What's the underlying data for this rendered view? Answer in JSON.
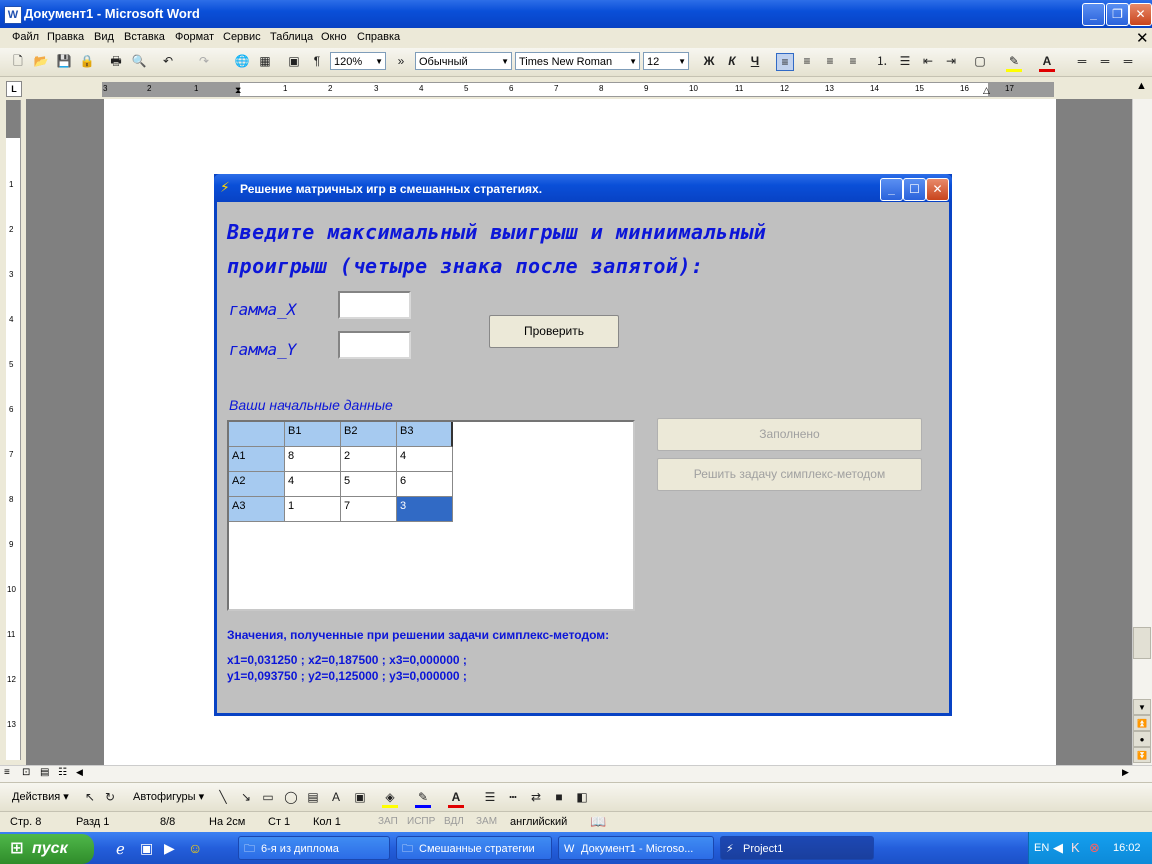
{
  "window": {
    "title": "Документ1 - Microsoft Word",
    "icon_label": "W"
  },
  "menu": [
    "Файл",
    "Правка",
    "Вид",
    "Вставка",
    "Формат",
    "Сервис",
    "Таблица",
    "Окно",
    "Справка"
  ],
  "toolbar": {
    "zoom": "120%",
    "style": "Обычный",
    "font": "Times New Roman",
    "size": "12",
    "bold": "Ж",
    "italic": "К",
    "underline": "Ч"
  },
  "ruler": {
    "ticks": [
      "3",
      "2",
      "1",
      "1",
      "2",
      "3",
      "4",
      "5",
      "6",
      "7",
      "8",
      "9",
      "10",
      "11",
      "12",
      "13",
      "14",
      "15",
      "16",
      "17"
    ]
  },
  "vruler": {
    "ticks": [
      "1",
      "2",
      "3",
      "4",
      "5",
      "6",
      "7",
      "8",
      "9",
      "10",
      "11",
      "12",
      "13"
    ]
  },
  "dialog": {
    "title": "Решение матричных игр в смешанных стратегиях.",
    "heading_line1": "Введите максимальный выигрыш и миниимальный",
    "heading_line2": "проигрыш (четыре знака после запятой):",
    "gamma_x_label": "гамма_X",
    "gamma_y_label": "гамма_Y",
    "gamma_x_value": "",
    "gamma_y_value": "",
    "check_button": "Проверить",
    "data_caption": "Ваши начальные данные",
    "grid": {
      "col_headers": [
        "B1",
        "B2",
        "B3"
      ],
      "rows": [
        {
          "label": "A1",
          "values": [
            "8",
            "2",
            "4"
          ]
        },
        {
          "label": "A2",
          "values": [
            "4",
            "5",
            "6"
          ]
        },
        {
          "label": "A3",
          "values": [
            "1",
            "7",
            "3"
          ]
        }
      ]
    },
    "filled_button": "Заполнено",
    "solve_button": "Решить задачу симплекс-методом",
    "results_caption": "Значения, полученные при решении задачи симплекс-методом:",
    "results_x": "x1=0,031250 ; x2=0,187500 ; x3=0,000000 ;",
    "results_y": "y1=0,093750 ; y2=0,125000 ; y3=0,000000 ;"
  },
  "drawbar": {
    "actions": "Действия",
    "autoshapes": "Автофигуры"
  },
  "status": {
    "page": "Стр. 8",
    "section": "Разд 1",
    "pages": "8/8",
    "at": "На 2см",
    "line": "Ст 1",
    "col": "Кол 1",
    "rec": "ЗАП",
    "trk": "ИСПР",
    "ext": "ВДЛ",
    "ovr": "ЗАМ",
    "lang": "английский"
  },
  "taskbar": {
    "start": "пуск",
    "tasks": [
      "6-я из диплома",
      "Смешанные стратегии",
      "Документ1 - Microso...",
      "Project1"
    ],
    "lang": "EN",
    "clock": "16:02"
  }
}
